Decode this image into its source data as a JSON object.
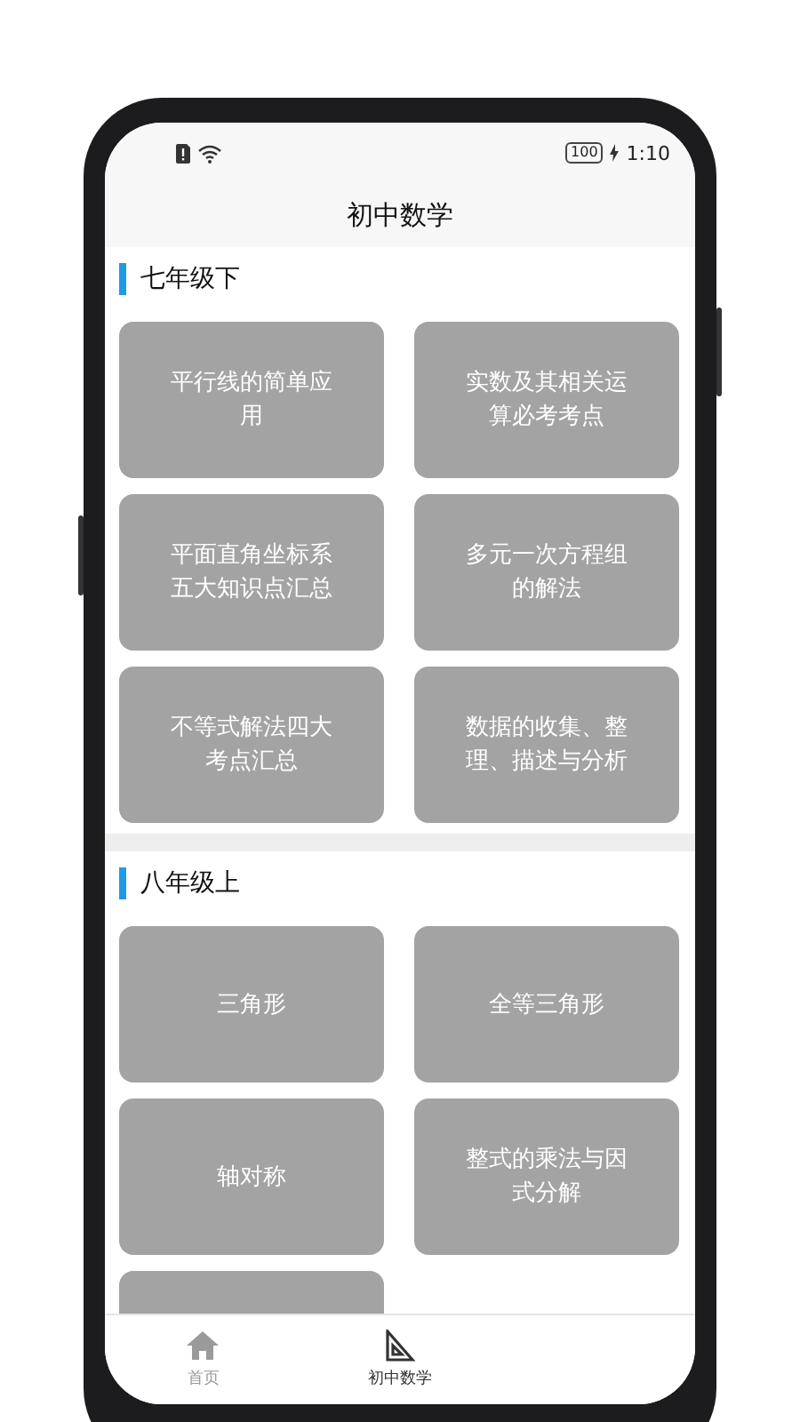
{
  "status_bar": {
    "battery": "100",
    "time": "1:10"
  },
  "title": "初中数学",
  "sections": [
    {
      "title": "七年级下",
      "items": [
        {
          "label": "平行线的简单应用"
        },
        {
          "label": "平面直角坐标系五大知识点汇总"
        },
        {
          "label": "不等式解法四大考点汇总"
        },
        {
          "label": "实数及其相关运算必考考点"
        },
        {
          "label": "多元一次方程组的解法"
        },
        {
          "label": "数据的收集、整理、描述与分析"
        }
      ]
    },
    {
      "title": "八年级上",
      "items": [
        {
          "label": "三角形"
        },
        {
          "label": "轴对称"
        },
        {
          "kind": "partial"
        },
        {
          "label": "全等三角形"
        },
        {
          "label": "整式的乘法与因式分解"
        }
      ]
    }
  ],
  "tabs": [
    {
      "label": "首页",
      "selected": false
    },
    {
      "label": "初中数学",
      "selected": true
    }
  ]
}
